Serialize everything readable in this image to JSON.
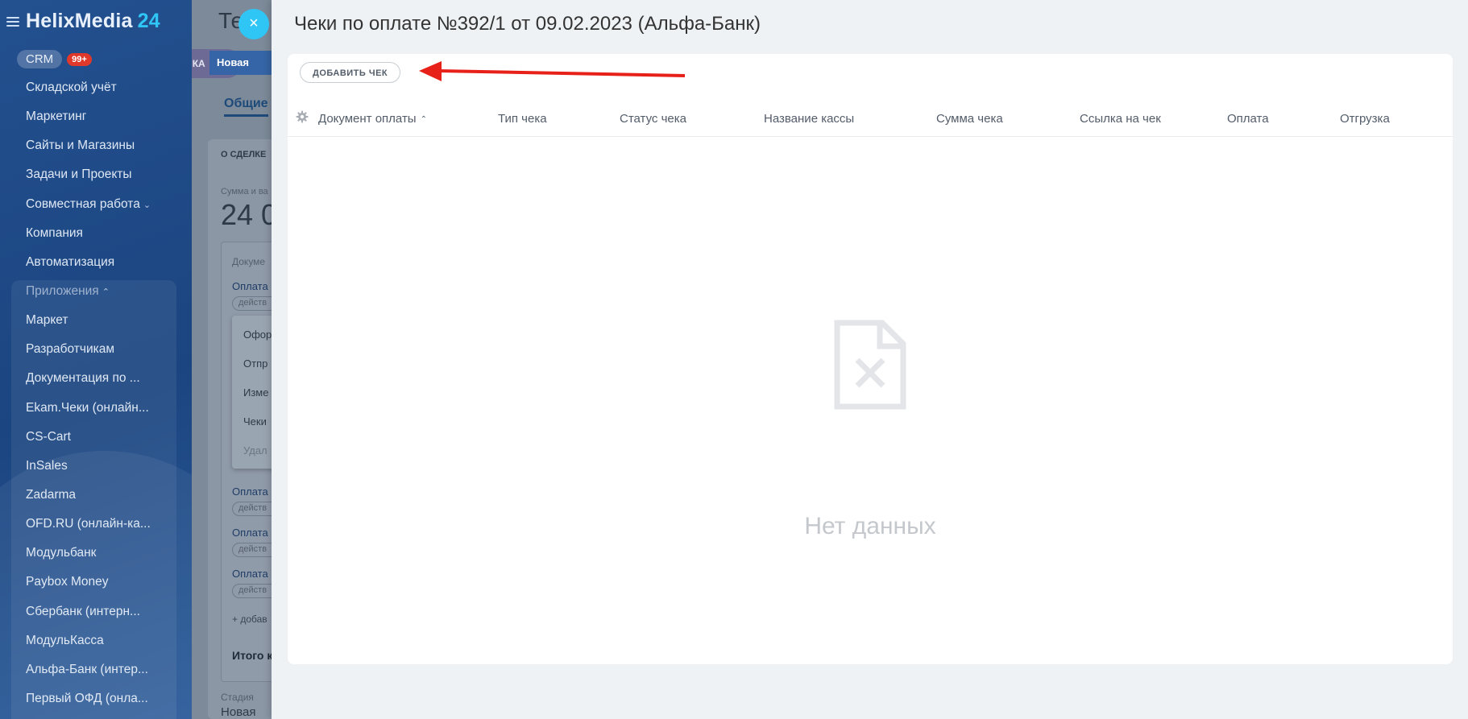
{
  "sidebar": {
    "logo_text": "HelixMedia",
    "logo_num": "24",
    "crm_label": "CRM",
    "crm_badge": "99+",
    "items": [
      {
        "label": "Складской учёт"
      },
      {
        "label": "Маркетинг"
      },
      {
        "label": "Сайты и Магазины"
      },
      {
        "label": "Задачи и Проекты"
      },
      {
        "label": "Совместная работа"
      },
      {
        "label": "Компания"
      },
      {
        "label": "Автоматизация"
      },
      {
        "label": "Приложения"
      },
      {
        "label": "Маркет"
      },
      {
        "label": "Разработчикам"
      },
      {
        "label": "Документация по ..."
      },
      {
        "label": "Ekam.Чеки (онлайн..."
      },
      {
        "label": "CS-Cart"
      },
      {
        "label": "InSales"
      },
      {
        "label": "Zadarma"
      },
      {
        "label": "OFD.RU (онлайн-ка..."
      },
      {
        "label": "Модульбанк"
      },
      {
        "label": "Paybox Money"
      },
      {
        "label": "Сбербанк (интерн..."
      },
      {
        "label": "МодульКасса"
      },
      {
        "label": "Альфа-Банк (интер..."
      },
      {
        "label": "Первый ОФД (онла..."
      }
    ]
  },
  "deal": {
    "title_partial": "Те",
    "close_symbol": "×",
    "entity_tab": "СДЕЛКА",
    "stage": "Новая",
    "tab_general": "Общие",
    "about_label": "О СДЕЛКЕ",
    "sum_label": "Сумма и ва",
    "sum_value": "24 0",
    "documents_label": "Докуме",
    "payment_link": "Оплата",
    "action_chip": "действ",
    "popup_items": [
      "Офор",
      "Отпр",
      "Изме",
      "Чеки",
      "Удал"
    ],
    "add_link": "+ добав",
    "total_label": "Итого к",
    "stage_label": "Стадия",
    "stage_value": "Новая"
  },
  "slider": {
    "title": "Чеки по оплате №392/1 от 09.02.2023 (Альфа-Банк)",
    "add_button": "ДОБАВИТЬ ЧЕК",
    "columns": [
      "Документ оплаты",
      "Тип чека",
      "Статус чека",
      "Название кассы",
      "Сумма чека",
      "Ссылка на чек",
      "Оплата",
      "Отгрузка"
    ],
    "sort_indicator": "^",
    "empty_text": "Нет данных"
  },
  "colors": {
    "accent": "#2fc6f6",
    "annotation_arrow": "#e8201a",
    "sidebar_bg": "#1d4a86"
  }
}
